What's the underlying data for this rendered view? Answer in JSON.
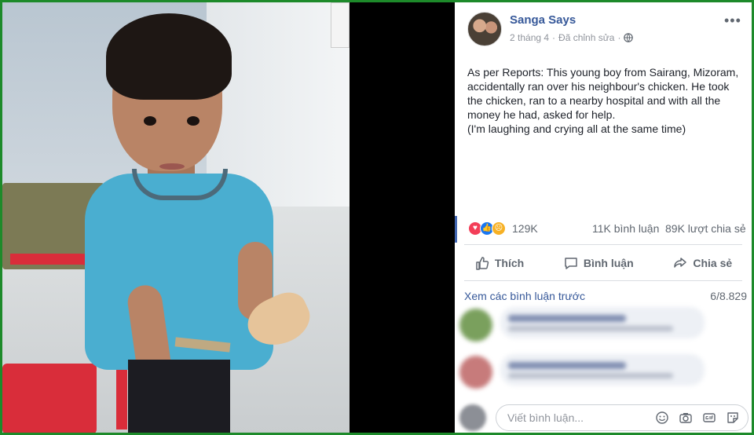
{
  "post": {
    "page_name": "Sanga Says",
    "date": "2 tháng 4",
    "separator": "·",
    "edited": "Đã chỉnh sửa",
    "text": "As per Reports: This young boy from Sairang, Mizoram, accidentally ran over his neighbour's chicken. He took the chicken, ran to a nearby hospital and with all the money he had, asked for help.\n(I'm laughing and crying all at the same time)"
  },
  "stats": {
    "reactions": "129K",
    "comments": "11K bình luận",
    "shares": "89K lượt chia sẻ"
  },
  "actions": {
    "like": "Thích",
    "comment": "Bình luận",
    "share": "Chia sẻ"
  },
  "comments": {
    "see_previous": "Xem các bình luận trước",
    "count": "6/8.829"
  },
  "compose": {
    "placeholder": "Viết bình luận..."
  },
  "colors": {
    "border": "#1d8a2a",
    "link": "#365899",
    "like": "#1877f2",
    "love": "#f33e58",
    "sad": "#f7b125"
  }
}
